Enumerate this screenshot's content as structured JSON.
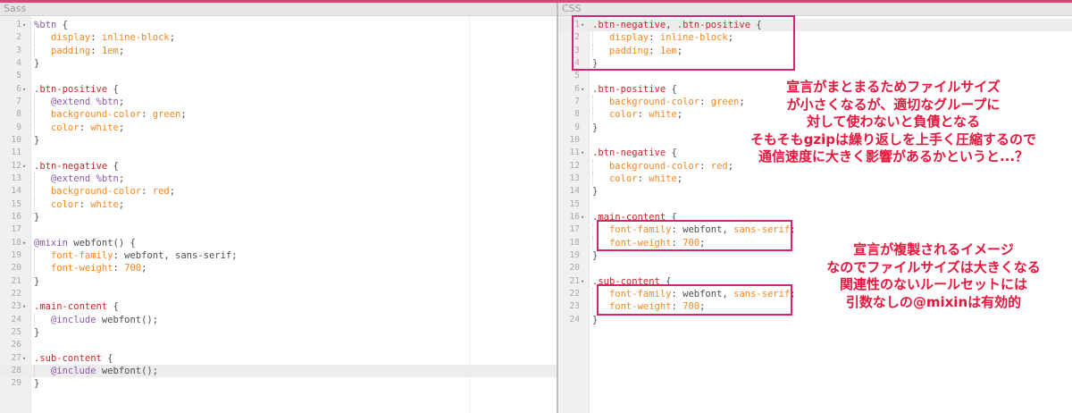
{
  "panes": {
    "sass": {
      "title": "Sass",
      "active_line": 28,
      "lines": [
        {
          "n": "1",
          "fold": true,
          "indent": 0,
          "tokens": [
            {
              "c": "ph",
              "t": "%btn"
            },
            {
              "c": "plain",
              "t": " {"
            }
          ]
        },
        {
          "n": "2",
          "indent": 1,
          "tokens": [
            {
              "c": "prop",
              "t": "display"
            },
            {
              "c": "plain",
              "t": ": "
            },
            {
              "c": "val",
              "t": "inline-block"
            },
            {
              "c": "plain",
              "t": ";"
            }
          ]
        },
        {
          "n": "3",
          "indent": 1,
          "tokens": [
            {
              "c": "prop",
              "t": "padding"
            },
            {
              "c": "plain",
              "t": ": "
            },
            {
              "c": "val",
              "t": "1em"
            },
            {
              "c": "plain",
              "t": ";"
            }
          ]
        },
        {
          "n": "4",
          "indent": 0,
          "tokens": [
            {
              "c": "plain",
              "t": "}"
            }
          ]
        },
        {
          "n": "5",
          "indent": 0,
          "tokens": []
        },
        {
          "n": "6",
          "fold": true,
          "indent": 0,
          "tokens": [
            {
              "c": "sel",
              "t": ".btn-positive"
            },
            {
              "c": "plain",
              "t": " {"
            }
          ]
        },
        {
          "n": "7",
          "indent": 1,
          "tokens": [
            {
              "c": "at",
              "t": "@extend"
            },
            {
              "c": "plain",
              "t": " "
            },
            {
              "c": "ph",
              "t": "%btn"
            },
            {
              "c": "plain",
              "t": ";"
            }
          ]
        },
        {
          "n": "8",
          "indent": 1,
          "tokens": [
            {
              "c": "prop",
              "t": "background-color"
            },
            {
              "c": "plain",
              "t": ": "
            },
            {
              "c": "val",
              "t": "green"
            },
            {
              "c": "plain",
              "t": ";"
            }
          ]
        },
        {
          "n": "9",
          "indent": 1,
          "tokens": [
            {
              "c": "prop",
              "t": "color"
            },
            {
              "c": "plain",
              "t": ": "
            },
            {
              "c": "val",
              "t": "white"
            },
            {
              "c": "plain",
              "t": ";"
            }
          ]
        },
        {
          "n": "10",
          "indent": 0,
          "tokens": [
            {
              "c": "plain",
              "t": "}"
            }
          ]
        },
        {
          "n": "11",
          "indent": 0,
          "tokens": []
        },
        {
          "n": "12",
          "fold": true,
          "indent": 0,
          "tokens": [
            {
              "c": "sel",
              "t": ".btn-negative"
            },
            {
              "c": "plain",
              "t": " {"
            }
          ]
        },
        {
          "n": "13",
          "indent": 1,
          "tokens": [
            {
              "c": "at",
              "t": "@extend"
            },
            {
              "c": "plain",
              "t": " "
            },
            {
              "c": "ph",
              "t": "%btn"
            },
            {
              "c": "plain",
              "t": ";"
            }
          ]
        },
        {
          "n": "14",
          "indent": 1,
          "tokens": [
            {
              "c": "prop",
              "t": "background-color"
            },
            {
              "c": "plain",
              "t": ": "
            },
            {
              "c": "val",
              "t": "red"
            },
            {
              "c": "plain",
              "t": ";"
            }
          ]
        },
        {
          "n": "15",
          "indent": 1,
          "tokens": [
            {
              "c": "prop",
              "t": "color"
            },
            {
              "c": "plain",
              "t": ": "
            },
            {
              "c": "val",
              "t": "white"
            },
            {
              "c": "plain",
              "t": ";"
            }
          ]
        },
        {
          "n": "16",
          "indent": 0,
          "tokens": [
            {
              "c": "plain",
              "t": "}"
            }
          ]
        },
        {
          "n": "17",
          "indent": 0,
          "tokens": []
        },
        {
          "n": "18",
          "fold": true,
          "indent": 0,
          "tokens": [
            {
              "c": "at",
              "t": "@mixin"
            },
            {
              "c": "plain",
              "t": " webfont() {"
            }
          ]
        },
        {
          "n": "19",
          "indent": 1,
          "tokens": [
            {
              "c": "prop",
              "t": "font-family"
            },
            {
              "c": "plain",
              "t": ": webfont, sans-serif;"
            }
          ]
        },
        {
          "n": "20",
          "indent": 1,
          "tokens": [
            {
              "c": "prop",
              "t": "font-weight"
            },
            {
              "c": "plain",
              "t": ": "
            },
            {
              "c": "val",
              "t": "700"
            },
            {
              "c": "plain",
              "t": ";"
            }
          ]
        },
        {
          "n": "21",
          "indent": 0,
          "tokens": [
            {
              "c": "plain",
              "t": "}"
            }
          ]
        },
        {
          "n": "22",
          "indent": 0,
          "tokens": []
        },
        {
          "n": "23",
          "fold": true,
          "indent": 0,
          "tokens": [
            {
              "c": "sel",
              "t": ".main-content"
            },
            {
              "c": "plain",
              "t": " {"
            }
          ]
        },
        {
          "n": "24",
          "indent": 1,
          "tokens": [
            {
              "c": "at",
              "t": "@include"
            },
            {
              "c": "plain",
              "t": " webfont();"
            }
          ]
        },
        {
          "n": "25",
          "indent": 0,
          "tokens": [
            {
              "c": "plain",
              "t": "}"
            }
          ]
        },
        {
          "n": "26",
          "indent": 0,
          "tokens": []
        },
        {
          "n": "27",
          "fold": true,
          "indent": 0,
          "tokens": [
            {
              "c": "sel",
              "t": ".sub-content"
            },
            {
              "c": "plain",
              "t": " {"
            }
          ]
        },
        {
          "n": "28",
          "indent": 1,
          "tokens": [
            {
              "c": "at",
              "t": "@include"
            },
            {
              "c": "plain",
              "t": " webfont();"
            }
          ]
        },
        {
          "n": "29",
          "indent": 0,
          "tokens": [
            {
              "c": "plain",
              "t": "}"
            }
          ]
        }
      ]
    },
    "css": {
      "title": "CSS",
      "active_line": 1,
      "lines": [
        {
          "n": "1",
          "fold": true,
          "indent": 0,
          "tokens": [
            {
              "c": "sel",
              "t": ".btn-negative"
            },
            {
              "c": "plain",
              "t": ", "
            },
            {
              "c": "sel",
              "t": ".btn-positive"
            },
            {
              "c": "plain",
              "t": " {"
            }
          ]
        },
        {
          "n": "2",
          "indent": 1,
          "tokens": [
            {
              "c": "prop",
              "t": "display"
            },
            {
              "c": "plain",
              "t": ": "
            },
            {
              "c": "val",
              "t": "inline-block"
            },
            {
              "c": "plain",
              "t": ";"
            }
          ]
        },
        {
          "n": "3",
          "indent": 1,
          "tokens": [
            {
              "c": "prop",
              "t": "padding"
            },
            {
              "c": "plain",
              "t": ": "
            },
            {
              "c": "val",
              "t": "1em"
            },
            {
              "c": "plain",
              "t": ";"
            }
          ]
        },
        {
          "n": "4",
          "indent": 0,
          "tokens": [
            {
              "c": "plain",
              "t": "}"
            }
          ]
        },
        {
          "n": "5",
          "indent": 0,
          "tokens": []
        },
        {
          "n": "6",
          "fold": true,
          "indent": 0,
          "tokens": [
            {
              "c": "sel",
              "t": ".btn-positive"
            },
            {
              "c": "plain",
              "t": " {"
            }
          ]
        },
        {
          "n": "7",
          "indent": 1,
          "tokens": [
            {
              "c": "prop",
              "t": "background-color"
            },
            {
              "c": "plain",
              "t": ": "
            },
            {
              "c": "val",
              "t": "green"
            },
            {
              "c": "plain",
              "t": ";"
            }
          ]
        },
        {
          "n": "8",
          "indent": 1,
          "tokens": [
            {
              "c": "prop",
              "t": "color"
            },
            {
              "c": "plain",
              "t": ": "
            },
            {
              "c": "val",
              "t": "white"
            },
            {
              "c": "plain",
              "t": ";"
            }
          ]
        },
        {
          "n": "9",
          "indent": 0,
          "tokens": [
            {
              "c": "plain",
              "t": "}"
            }
          ]
        },
        {
          "n": "10",
          "indent": 0,
          "tokens": []
        },
        {
          "n": "11",
          "fold": true,
          "indent": 0,
          "tokens": [
            {
              "c": "sel",
              "t": ".btn-negative"
            },
            {
              "c": "plain",
              "t": " {"
            }
          ]
        },
        {
          "n": "12",
          "indent": 1,
          "tokens": [
            {
              "c": "prop",
              "t": "background-color"
            },
            {
              "c": "plain",
              "t": ": "
            },
            {
              "c": "val",
              "t": "red"
            },
            {
              "c": "plain",
              "t": ";"
            }
          ]
        },
        {
          "n": "13",
          "indent": 1,
          "tokens": [
            {
              "c": "prop",
              "t": "color"
            },
            {
              "c": "plain",
              "t": ": "
            },
            {
              "c": "val",
              "t": "white"
            },
            {
              "c": "plain",
              "t": ";"
            }
          ]
        },
        {
          "n": "14",
          "indent": 0,
          "tokens": [
            {
              "c": "plain",
              "t": "}"
            }
          ]
        },
        {
          "n": "15",
          "indent": 0,
          "tokens": []
        },
        {
          "n": "16",
          "fold": true,
          "indent": 0,
          "tokens": [
            {
              "c": "sel",
              "t": ".main-content"
            },
            {
              "c": "plain",
              "t": " {"
            }
          ]
        },
        {
          "n": "17",
          "indent": 1,
          "tokens": [
            {
              "c": "prop",
              "t": "font-family"
            },
            {
              "c": "plain",
              "t": ": webfont, "
            },
            {
              "c": "val",
              "t": "sans-serif"
            },
            {
              "c": "plain",
              "t": ";"
            }
          ]
        },
        {
          "n": "18",
          "indent": 1,
          "tokens": [
            {
              "c": "prop",
              "t": "font-weight"
            },
            {
              "c": "plain",
              "t": ": "
            },
            {
              "c": "val",
              "t": "700"
            },
            {
              "c": "plain",
              "t": ";"
            }
          ]
        },
        {
          "n": "19",
          "indent": 0,
          "tokens": [
            {
              "c": "plain",
              "t": "}"
            }
          ]
        },
        {
          "n": "20",
          "indent": 0,
          "tokens": []
        },
        {
          "n": "21",
          "fold": true,
          "indent": 0,
          "tokens": [
            {
              "c": "sel",
              "t": ".sub-content"
            },
            {
              "c": "plain",
              "t": " {"
            }
          ]
        },
        {
          "n": "22",
          "indent": 1,
          "tokens": [
            {
              "c": "prop",
              "t": "font-family"
            },
            {
              "c": "plain",
              "t": ": webfont, "
            },
            {
              "c": "val",
              "t": "sans-serif"
            },
            {
              "c": "plain",
              "t": ";"
            }
          ]
        },
        {
          "n": "23",
          "indent": 1,
          "tokens": [
            {
              "c": "prop",
              "t": "font-weight"
            },
            {
              "c": "plain",
              "t": ": "
            },
            {
              "c": "val",
              "t": "700"
            },
            {
              "c": "plain",
              "t": ";"
            }
          ]
        },
        {
          "n": "24",
          "indent": 0,
          "tokens": [
            {
              "c": "plain",
              "t": "}"
            }
          ]
        }
      ]
    }
  },
  "annotations": {
    "note1": [
      "宣言がまとまるためファイルサイズ",
      "が小さくなるが、適切なグループに",
      "対して使わないと負債となる",
      "そもそもgzipは繰り返しを上手く圧縮するので",
      "通信速度に大きく影響があるかというと...？"
    ],
    "note2": [
      "宣言が複製されるイメージ",
      "なのでファイルサイズは大きくなる",
      "関連性のないルールセットには",
      "引数なしの@mixinは有効的"
    ]
  },
  "colors": {
    "accent": "#e1417a",
    "box": "#d6246e",
    "note": "#e8163c"
  }
}
